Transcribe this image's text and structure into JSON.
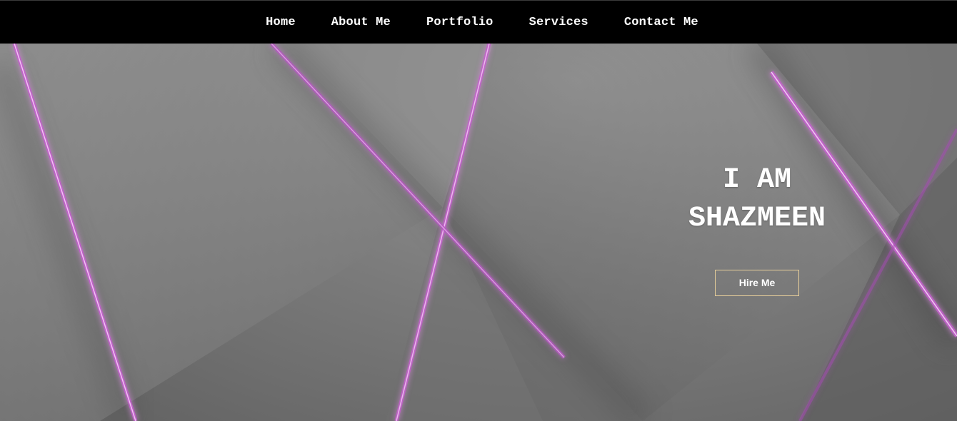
{
  "nav": {
    "items": [
      {
        "label": "Home"
      },
      {
        "label": "About Me"
      },
      {
        "label": "Portfolio"
      },
      {
        "label": "Services"
      },
      {
        "label": "Contact Me"
      }
    ]
  },
  "hero": {
    "title_line1": "I AM",
    "title_line2": "SHAZMEEN",
    "button_label": "Hire Me"
  },
  "colors": {
    "navbar_bg": "#000000",
    "hero_bg": "#7c7c7c",
    "light_streak": "#d070d8",
    "button_border": "#e8cf9a",
    "text": "#ffffff"
  }
}
